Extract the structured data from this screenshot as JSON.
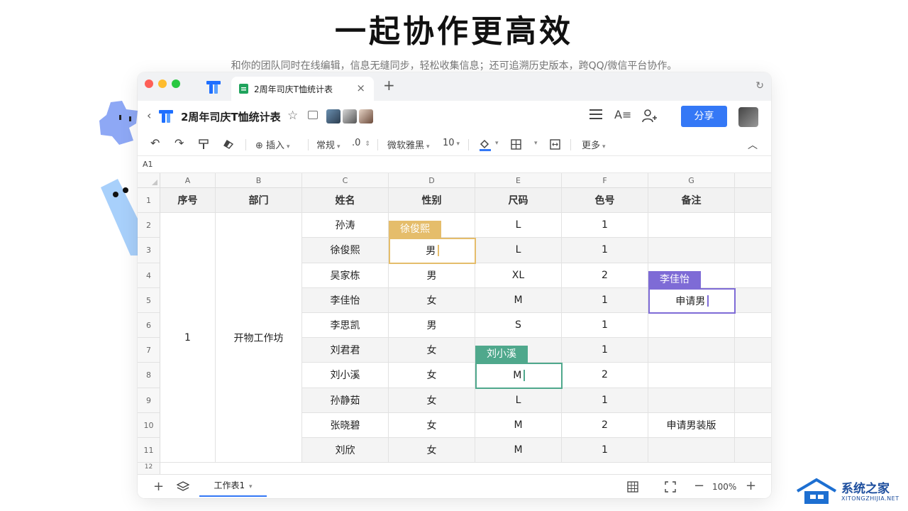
{
  "hero": {
    "title": "一起协作更高效",
    "subtitle": "和你的团队同时在线编辑，信息无缝同步，轻松收集信息；还可追溯历史版本，跨QQ/微信平台协作。"
  },
  "tabbar": {
    "tab_label": "2周年司庆T恤统计表",
    "close": "×",
    "new_tab": "+",
    "refresh": "↻"
  },
  "titlebar": {
    "back": "‹",
    "doc_title": "2周年司庆T恤统计表",
    "star": "☆",
    "font_icon": "A≡",
    "share_label": "分享"
  },
  "toolbar": {
    "undo": "↶",
    "redo": "↷",
    "format_painter": "⌂",
    "eraser": "⌫",
    "insert": "插入",
    "number_format": "常规",
    "decimal": ".0",
    "font_name": "微软雅黑",
    "font_size": "10",
    "more": "更多",
    "collapse": "︿"
  },
  "formula": {
    "cell_ref": "A1"
  },
  "grid": {
    "columns": [
      "A",
      "B",
      "C",
      "D",
      "E",
      "F",
      "G"
    ],
    "row_numbers": [
      "1",
      "2",
      "3",
      "4",
      "5",
      "6",
      "7",
      "8",
      "9",
      "10",
      "11",
      "12"
    ],
    "headers": [
      "序号",
      "部门",
      "姓名",
      "性别",
      "尺码",
      "色号",
      "备注"
    ],
    "merged": {
      "seq": "1",
      "dept": "开物工作坊"
    },
    "rows": [
      {
        "name": "孙涛",
        "gender": "",
        "size": "L",
        "color": "1",
        "note": ""
      },
      {
        "name": "徐俊熙",
        "gender": "",
        "size": "L",
        "color": "1",
        "note": ""
      },
      {
        "name": "吴家栋",
        "gender": "男",
        "size": "XL",
        "color": "2",
        "note": ""
      },
      {
        "name": "李佳怡",
        "gender": "女",
        "size": "M",
        "color": "1",
        "note": ""
      },
      {
        "name": "李思凯",
        "gender": "男",
        "size": "S",
        "color": "1",
        "note": ""
      },
      {
        "name": "刘君君",
        "gender": "女",
        "size": "",
        "color": "1",
        "note": ""
      },
      {
        "name": "刘小溪",
        "gender": "女",
        "size": "",
        "color": "2",
        "note": ""
      },
      {
        "name": "孙静茹",
        "gender": "女",
        "size": "L",
        "color": "1",
        "note": ""
      },
      {
        "name": "张晓碧",
        "gender": "女",
        "size": "M",
        "color": "2",
        "note": "申请男装版"
      },
      {
        "name": "刘欣",
        "gender": "女",
        "size": "M",
        "color": "1",
        "note": ""
      }
    ]
  },
  "collaborators": [
    {
      "name": "徐俊熙",
      "value": "男",
      "color": "#e5bd6b"
    },
    {
      "name": "李佳怡",
      "value": "申请男",
      "color": "#7e6bd6"
    },
    {
      "name": "刘小溪",
      "value": "M",
      "color": "#4fa88c"
    }
  ],
  "bottombar": {
    "add": "+",
    "sheet_tab": "工作表1",
    "zoom_minus": "−",
    "zoom": "100%",
    "zoom_plus": "+"
  },
  "watermark": {
    "text": "系统之家",
    "sub": "XITONGZHIJIA.NET"
  }
}
